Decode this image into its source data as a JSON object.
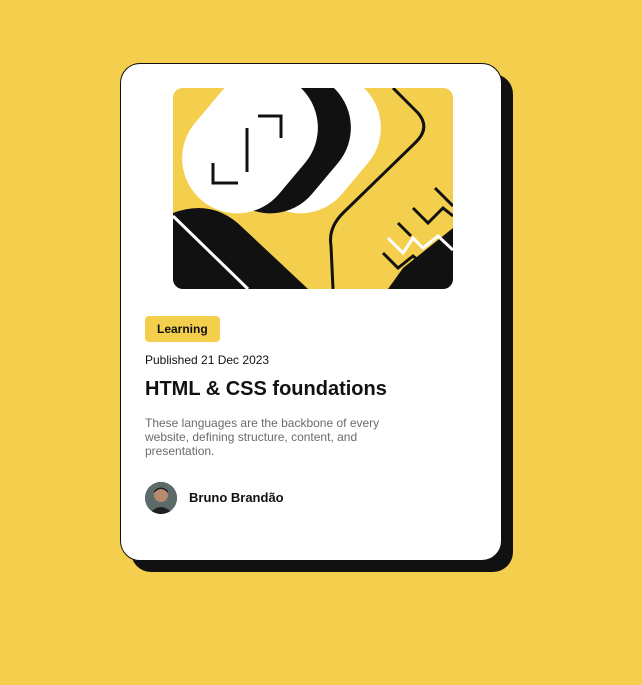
{
  "card": {
    "category": "Learning",
    "published": "Published 21 Dec 2023",
    "title": "HTML & CSS foundations",
    "description": "These languages are the backbone of every website, defining structure, content, and presentation.",
    "author": {
      "name": "Bruno Brandão"
    }
  },
  "colors": {
    "background": "#F4CE4D",
    "card": "#FFFFFF",
    "shadow": "#111111",
    "text": "#111111",
    "muted_text": "#6B6B6B",
    "tag_background": "#F4CE4D"
  },
  "icons": {
    "hero": "abstract-illustration",
    "avatar": "author-avatar"
  }
}
